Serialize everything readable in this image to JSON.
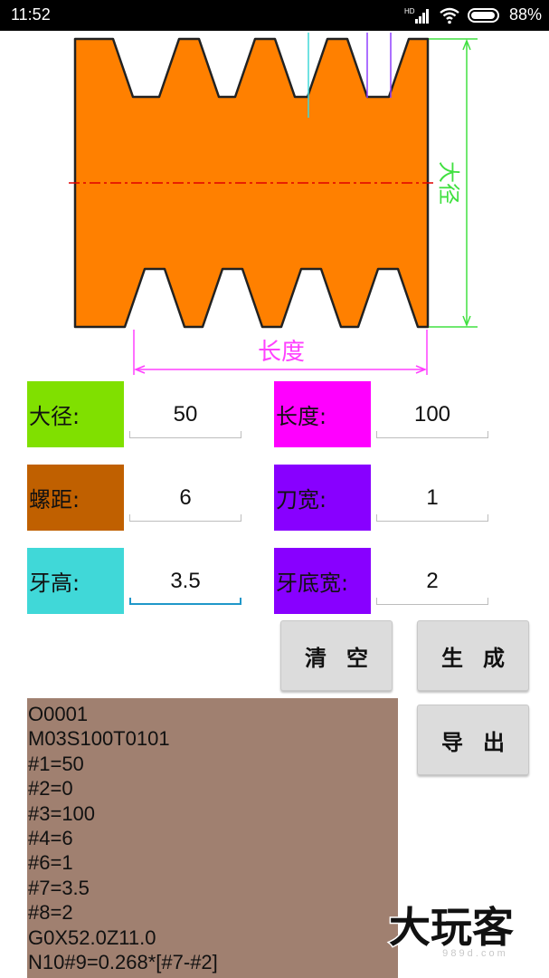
{
  "status_bar": {
    "time": "11:52",
    "network": "HD",
    "battery": "88%"
  },
  "diagram": {
    "major_diameter_label": "大径",
    "length_label": "长度"
  },
  "fields": [
    {
      "label": "大径:",
      "value": "50",
      "color": "#80e000"
    },
    {
      "label": "长度:",
      "value": "100",
      "color": "#ff00ff"
    },
    {
      "label": "螺距:",
      "value": "6",
      "color": "#c06000"
    },
    {
      "label": "刀宽:",
      "value": "1",
      "color": "#8800ff"
    },
    {
      "label": "牙高:",
      "value": "3.5",
      "color": "#40d8d8"
    },
    {
      "label": "牙底宽:",
      "value": "2",
      "color": "#8800ff"
    }
  ],
  "buttons": {
    "clear": "清空",
    "generate": "生成",
    "export": "导出"
  },
  "output_lines": [
    "O0001",
    "M03S100T0101",
    "#1=50",
    "#2=0",
    "#3=100",
    "#4=6",
    "#6=1",
    "#7=3.5",
    "#8=2",
    "G0X52.0Z11.0",
    "N10#9=0.268*[#7-#2]"
  ],
  "watermark": {
    "text": "大玩客",
    "url": "9 8 9 d . c o m"
  }
}
